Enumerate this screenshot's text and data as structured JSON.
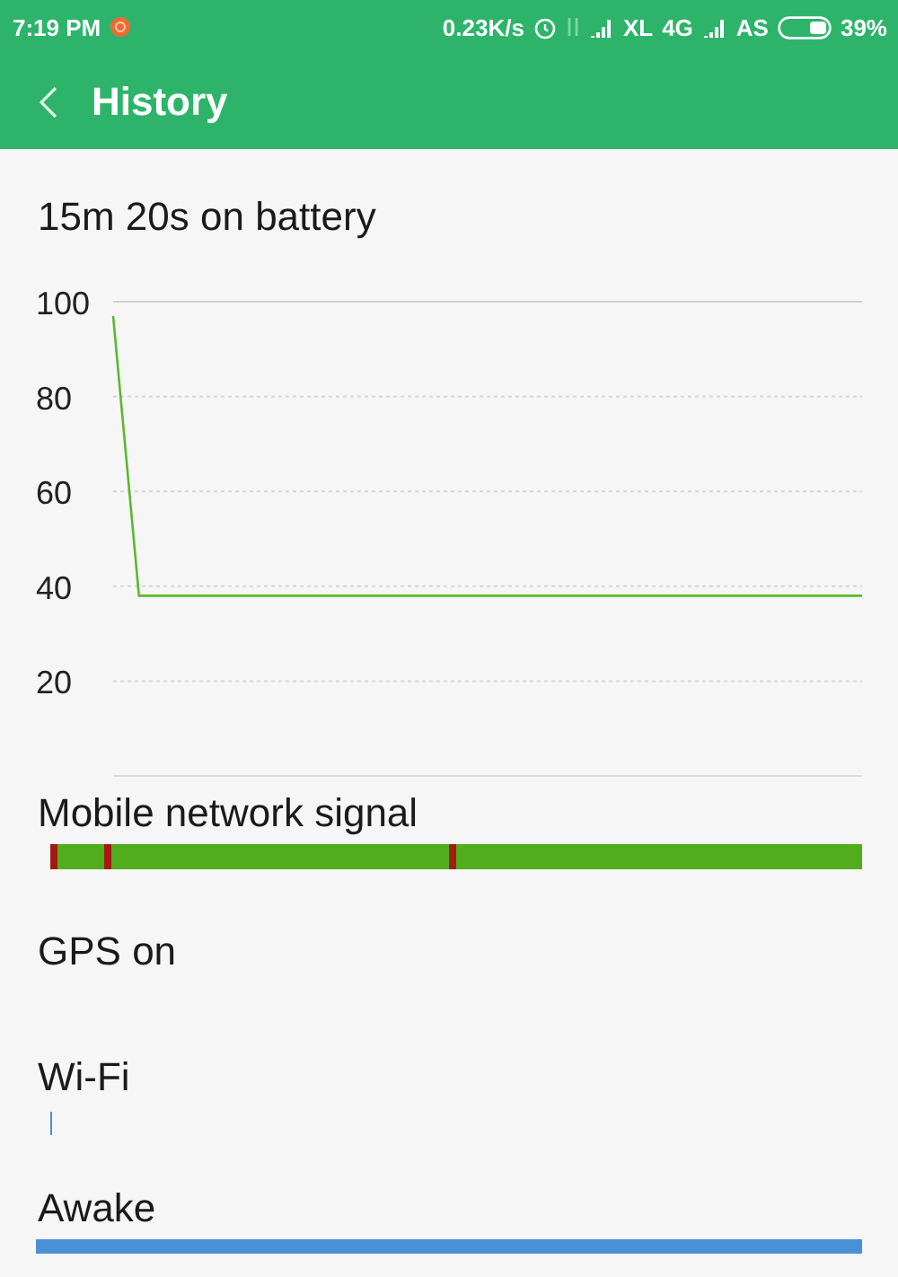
{
  "status_bar": {
    "time": "7:19 PM",
    "speed": "0.23K/s",
    "carrier_1": "XL",
    "network": "4G",
    "carrier_2": "AS",
    "battery": "39%"
  },
  "app_bar": {
    "title": "History"
  },
  "summary": "15m 20s on battery",
  "chart_data": {
    "type": "line",
    "grid": true,
    "yticks": [
      20,
      40,
      60,
      80,
      100
    ],
    "ylim": [
      0,
      100
    ],
    "series": [
      {
        "color": "#5cb82e",
        "values": [
          97,
          38,
          38,
          38,
          38,
          38,
          38,
          38,
          38,
          38,
          38,
          38,
          38,
          38,
          38,
          38,
          38,
          38,
          38,
          38,
          38,
          38,
          38,
          38,
          38,
          38,
          38,
          38,
          38,
          38
        ]
      }
    ]
  },
  "sections": [
    {
      "label": "Mobile network signal",
      "kind": "segments",
      "marks": [
        {
          "color": "#a31a14",
          "level": 0.0
        },
        {
          "color": "#a31a14",
          "level": 0.068
        },
        {
          "color": "#a31a14",
          "level": 0.496
        }
      ]
    },
    {
      "label": "GPS on",
      "kind": "empty"
    },
    {
      "label": "Wi-Fi",
      "kind": "tick"
    },
    {
      "label": "Awake",
      "kind": "full"
    }
  ]
}
